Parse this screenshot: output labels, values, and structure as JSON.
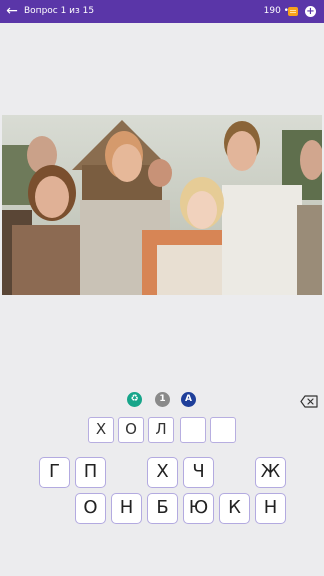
{
  "header": {
    "back_icon": "arrow-left-icon",
    "title": "Вопрос 1 из 15",
    "coins": "190 •",
    "coin_icon": "coins-icon",
    "add_icon": "plus-circle-icon",
    "background_color": "#5a36a8"
  },
  "hints": [
    {
      "name": "delete-letters-hint",
      "icon": "trash-icon",
      "glyph": "🗑",
      "color": "#17a58a"
    },
    {
      "name": "open-letter-hint",
      "icon": "number-one-icon",
      "glyph": "1",
      "color": "#8a8a8a"
    },
    {
      "name": "show-answer-hint",
      "icon": "letter-a-icon",
      "glyph": "A",
      "color": "#1f3f9a"
    }
  ],
  "backspace_icon": "backspace-icon",
  "answer_slots": [
    "Х",
    "О",
    "Л",
    "",
    ""
  ],
  "keyboard": {
    "row1": [
      "Г",
      "П",
      "",
      "Х",
      "Ч",
      "",
      "Ж"
    ],
    "row2": [
      "О",
      "Н",
      "Б",
      "Ю",
      "К",
      "Н"
    ]
  }
}
